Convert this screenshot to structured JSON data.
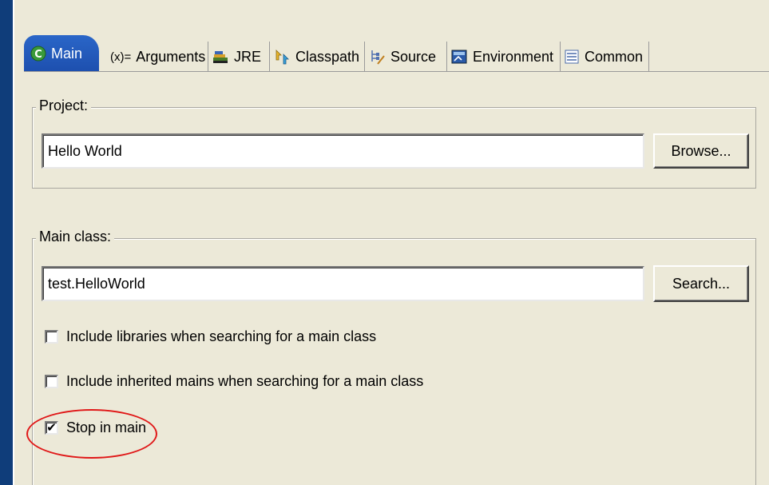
{
  "tabs": [
    {
      "label": "Main",
      "icon": "java-class-icon",
      "active": true
    },
    {
      "label": "Arguments",
      "icon": "variable-x-icon",
      "prefix": "(x)="
    },
    {
      "label": "JRE",
      "icon": "library-books-icon"
    },
    {
      "label": "Classpath",
      "icon": "classpath-arrows-icon"
    },
    {
      "label": "Source",
      "icon": "source-tree-icon"
    },
    {
      "label": "Environment",
      "icon": "environment-icon"
    },
    {
      "label": "Common",
      "icon": "common-list-icon"
    }
  ],
  "project": {
    "label": "Project:",
    "value": "Hello World",
    "browse_label": "Browse..."
  },
  "main_class": {
    "label": "Main class:",
    "value": "test.HelloWorld",
    "search_label": "Search...",
    "options": [
      {
        "label": "Include libraries when searching for a main class",
        "checked": false
      },
      {
        "label": "Include inherited mains when searching for a main class",
        "checked": false
      },
      {
        "label": "Stop in main",
        "checked": true
      }
    ]
  },
  "colors": {
    "active_tab": "#2a66c8",
    "panel": "#ece9d8",
    "background": "#0f3d7a",
    "annotation": "#e01818"
  }
}
